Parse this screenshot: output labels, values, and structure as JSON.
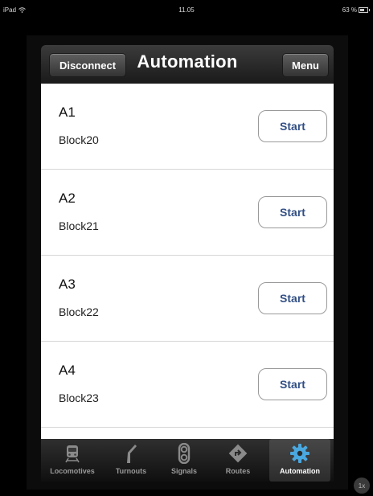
{
  "status_bar": {
    "device": "iPad",
    "time": "11.05",
    "battery": "63 %"
  },
  "nav": {
    "left_button": "Disconnect",
    "title": "Automation",
    "right_button": "Menu"
  },
  "automations": [
    {
      "name": "A1",
      "block": "Block20",
      "action": "Start"
    },
    {
      "name": "A2",
      "block": "Block21",
      "action": "Start"
    },
    {
      "name": "A3",
      "block": "Block22",
      "action": "Start"
    },
    {
      "name": "A4",
      "block": "Block23",
      "action": "Start"
    }
  ],
  "tabs": [
    {
      "label": "Locomotives",
      "icon": "train-icon"
    },
    {
      "label": "Turnouts",
      "icon": "turnout-icon"
    },
    {
      "label": "Signals",
      "icon": "signal-icon"
    },
    {
      "label": "Routes",
      "icon": "route-icon"
    },
    {
      "label": "Automation",
      "icon": "gear-icon",
      "selected": true
    }
  ],
  "zoom": "1x",
  "colors": {
    "accent": "#324f85",
    "tab_selected_icon": "#4aa8e0"
  }
}
